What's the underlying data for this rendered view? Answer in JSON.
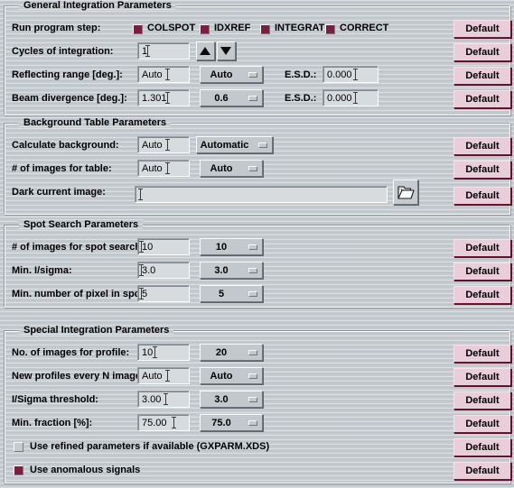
{
  "theme": {
    "accent_maroon": "#7a1f3d",
    "button_pink": "#e9cdd8",
    "panel_gray": "#c6cbd0",
    "field_gray": "#d7dbde"
  },
  "default_button_label": "Default",
  "sections": [
    {
      "id": "general",
      "title": "General Integration Parameters",
      "rows": [
        {
          "id": "run-program-step",
          "label": "Run program step:",
          "checkboxes": [
            {
              "label": "COLSPOT",
              "checked": true
            },
            {
              "label": "IDXREF",
              "checked": true
            },
            {
              "label": "INTEGRAT",
              "checked": true
            },
            {
              "label": "CORRECT",
              "checked": true
            }
          ]
        },
        {
          "id": "cycles-of-integration",
          "label": "Cycles of integration:",
          "field_value": "1",
          "spinner_up": "increment-arrow",
          "spinner_down": "decrement-arrow"
        },
        {
          "id": "reflecting-range",
          "label": "Reflecting range [deg.]:",
          "field_value": "Auto",
          "dropdown_value": "Auto",
          "esd_label": "E.S.D.:",
          "esd_value": "0.000"
        },
        {
          "id": "beam-divergence",
          "label": "Beam divergence [deg.]:",
          "field_value": "1.301",
          "dropdown_value": "0.6",
          "esd_label": "E.S.D.:",
          "esd_value": "0.000"
        }
      ]
    },
    {
      "id": "background-table",
      "title": "Background Table Parameters",
      "rows": [
        {
          "id": "calculate-background",
          "label": "Calculate background:",
          "field_value": "Auto",
          "dropdown_value": "Automatic"
        },
        {
          "id": "number-of-images-for-table",
          "label": "# of images for table:",
          "field_value": "Auto",
          "dropdown_value": "Auto"
        },
        {
          "id": "dark-current-image",
          "label": "Dark current image:",
          "field_value": "",
          "browse_icon": "folder-icon"
        }
      ]
    },
    {
      "id": "spot-search",
      "title": "Spot Search Parameters",
      "rows": [
        {
          "id": "number-of-images-for-spot-search",
          "label": "# of images for spot search:",
          "field_value": "10",
          "dropdown_value": "10"
        },
        {
          "id": "min-i-sigma",
          "label": "Min. I/sigma:",
          "field_value": "3.0",
          "dropdown_value": "3.0"
        },
        {
          "id": "min-number-of-pixel-in-spot",
          "label": "Min. number of pixel in spot:",
          "field_value": "5",
          "dropdown_value": "5"
        }
      ]
    },
    {
      "id": "special-integration",
      "title": "Special Integration Parameters",
      "rows": [
        {
          "id": "no-of-images-for-profile",
          "label": "No. of images for profile:",
          "field_value": "10",
          "dropdown_value": "20"
        },
        {
          "id": "new-profiles-every-n-images",
          "label": "New profiles every N images:",
          "field_value": "Auto",
          "dropdown_value": "Auto"
        },
        {
          "id": "i-sigma-threshold",
          "label": "I/Sigma threshold:",
          "field_value": "3.00",
          "dropdown_value": "3.0"
        },
        {
          "id": "min-fraction",
          "label": "Min. fraction [%]:",
          "field_value": "75.00",
          "dropdown_value": "75.0"
        },
        {
          "id": "use-refined-parameters",
          "checkbox_label": "Use refined parameters if available (GXPARM.XDS)",
          "checked": false
        },
        {
          "id": "use-anomalous-signals",
          "checkbox_label": "Use anomalous signals",
          "checked": true
        }
      ]
    }
  ]
}
